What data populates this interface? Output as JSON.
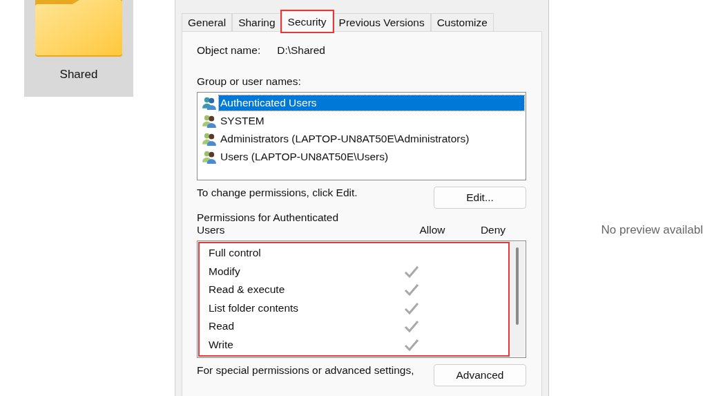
{
  "explorer": {
    "folder": {
      "label": "Shared",
      "selected": true
    }
  },
  "dialog": {
    "tabs": [
      {
        "label": "General",
        "selected": false,
        "highlighted": false
      },
      {
        "label": "Sharing",
        "selected": false,
        "highlighted": false
      },
      {
        "label": "Security",
        "selected": true,
        "highlighted": true
      },
      {
        "label": "Previous Versions",
        "selected": false,
        "highlighted": false
      },
      {
        "label": "Customize",
        "selected": false,
        "highlighted": false
      }
    ],
    "object_name_label": "Object name:",
    "object_name": "D:\\Shared",
    "group_label": "Group or user names:",
    "groups": [
      {
        "name": "Authenticated Users",
        "selected": true
      },
      {
        "name": "SYSTEM",
        "selected": false
      },
      {
        "name": "Administrators (LAPTOP-UN8AT50E\\Administrators)",
        "selected": false
      },
      {
        "name": "Users (LAPTOP-UN8AT50E\\Users)",
        "selected": false
      }
    ],
    "change_hint": "To change permissions, click Edit.",
    "edit_button": "Edit...",
    "permissions_label": "Permissions for Authenticated Users",
    "allow_header": "Allow",
    "deny_header": "Deny",
    "permissions_highlighted": true,
    "permissions": [
      {
        "name": "Full control",
        "allow": false,
        "deny": false
      },
      {
        "name": "Modify",
        "allow": true,
        "deny": false
      },
      {
        "name": "Read & execute",
        "allow": true,
        "deny": false
      },
      {
        "name": "List folder contents",
        "allow": true,
        "deny": false
      },
      {
        "name": "Read",
        "allow": true,
        "deny": false
      },
      {
        "name": "Write",
        "allow": true,
        "deny": false
      }
    ],
    "advanced_hint": "For special permissions or advanced settings,",
    "advanced_button": "Advanced"
  },
  "preview": {
    "message": "No preview availabl"
  }
}
